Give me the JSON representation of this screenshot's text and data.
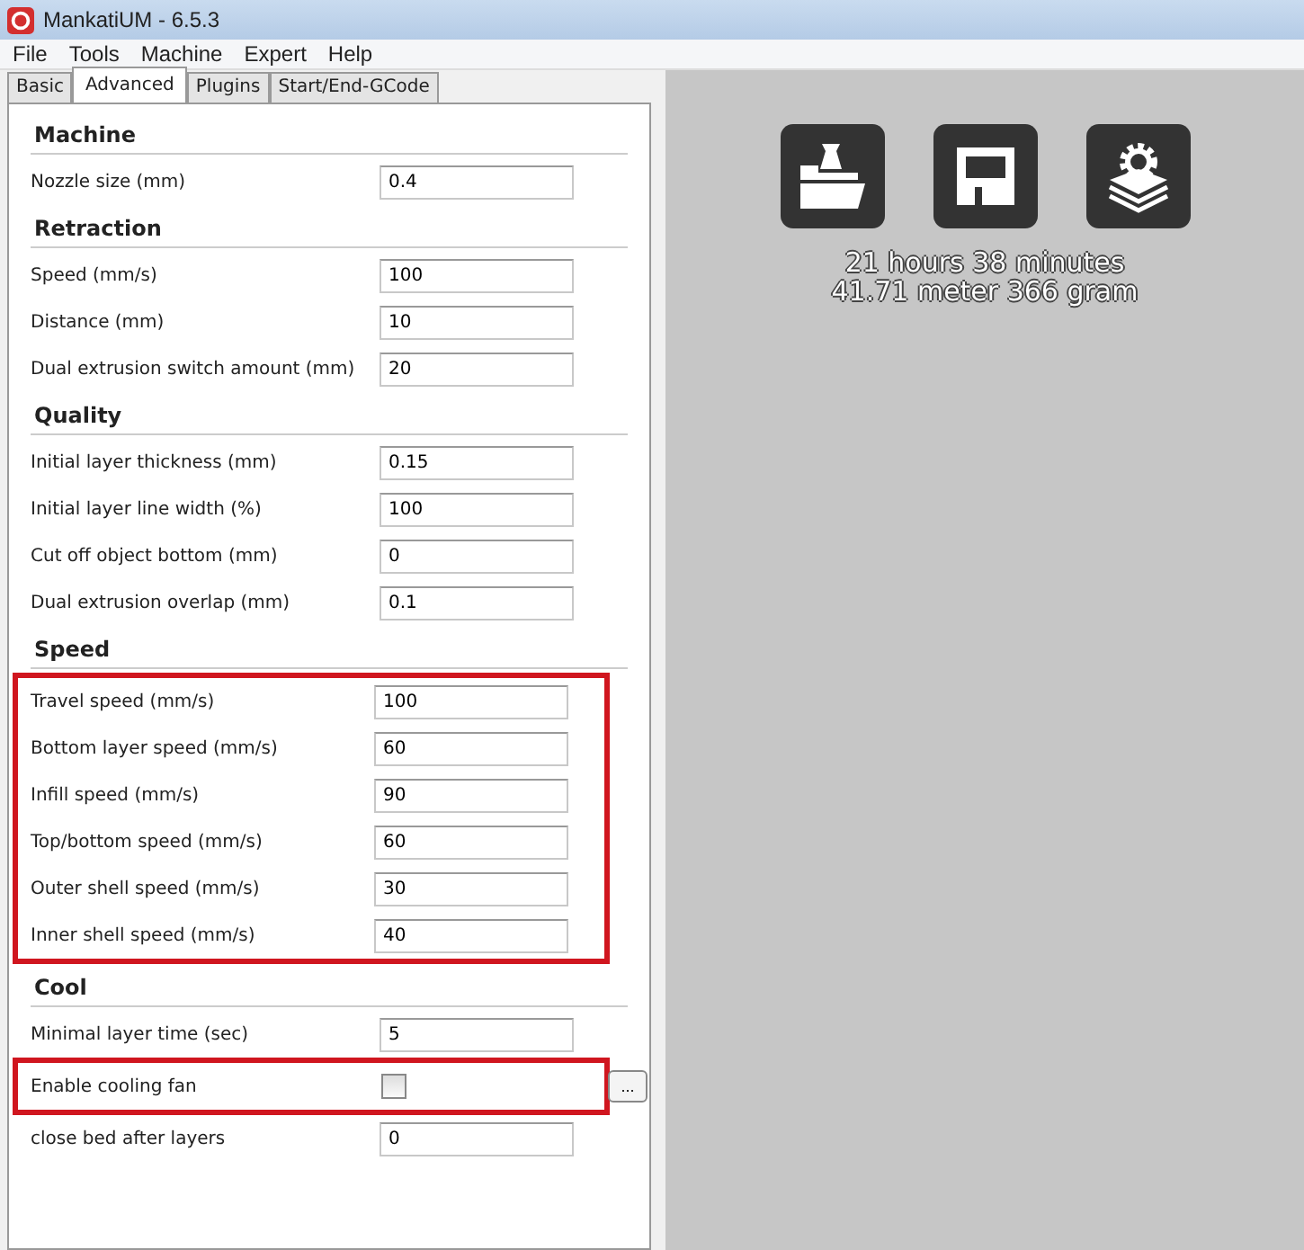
{
  "window": {
    "title": "MankatiUM - 6.5.3"
  },
  "menu": [
    "File",
    "Tools",
    "Machine",
    "Expert",
    "Help"
  ],
  "tabs": [
    {
      "label": "Basic",
      "selected": false
    },
    {
      "label": "Advanced",
      "selected": true
    },
    {
      "label": "Plugins",
      "selected": false
    },
    {
      "label": "Start/End-GCode",
      "selected": false
    }
  ],
  "sections": [
    {
      "title": "Machine",
      "rows": [
        {
          "kind": "field",
          "label": "Nozzle size (mm)",
          "value": "0.4",
          "highlighted": false
        }
      ]
    },
    {
      "title": "Retraction",
      "rows": [
        {
          "kind": "field",
          "label": "Speed (mm/s)",
          "value": "100",
          "highlighted": false
        },
        {
          "kind": "field",
          "label": "Distance (mm)",
          "value": "10",
          "highlighted": false
        },
        {
          "kind": "field",
          "label": "Dual extrusion switch amount (mm)",
          "value": "20",
          "highlighted": false
        }
      ]
    },
    {
      "title": "Quality",
      "rows": [
        {
          "kind": "field",
          "label": "Initial layer thickness (mm)",
          "value": "0.15",
          "highlighted": false
        },
        {
          "kind": "field",
          "label": "Initial layer line width (%)",
          "value": "100",
          "highlighted": false
        },
        {
          "kind": "field",
          "label": "Cut off object bottom (mm)",
          "value": "0",
          "highlighted": false
        },
        {
          "kind": "field",
          "label": "Dual extrusion overlap (mm)",
          "value": "0.1",
          "highlighted": false
        }
      ]
    },
    {
      "title": "Speed",
      "rows": [
        {
          "kind": "field",
          "label": "Travel speed (mm/s)",
          "value": "100",
          "highlighted": true
        },
        {
          "kind": "field",
          "label": "Bottom layer speed (mm/s)",
          "value": "60",
          "highlighted": true
        },
        {
          "kind": "field",
          "label": "Infill speed (mm/s)",
          "value": "90",
          "highlighted": true
        },
        {
          "kind": "field",
          "label": "Top/bottom speed (mm/s)",
          "value": "60",
          "highlighted": true
        },
        {
          "kind": "field",
          "label": "Outer shell speed (mm/s)",
          "value": "30",
          "highlighted": true
        },
        {
          "kind": "field",
          "label": "Inner shell speed (mm/s)",
          "value": "40",
          "highlighted": true
        }
      ]
    },
    {
      "title": "Cool",
      "rows": [
        {
          "kind": "field",
          "label": "Minimal layer time (sec)",
          "value": "5",
          "highlighted": false
        },
        {
          "kind": "checkbox",
          "label": "Enable cooling fan",
          "checked": false,
          "button": "...",
          "highlighted": true
        },
        {
          "kind": "field",
          "label": "close bed after layers",
          "value": "0",
          "highlighted": false
        }
      ]
    }
  ],
  "result": {
    "time": "21 hours 38 minutes",
    "material": "41.71 meter 366 gram"
  }
}
